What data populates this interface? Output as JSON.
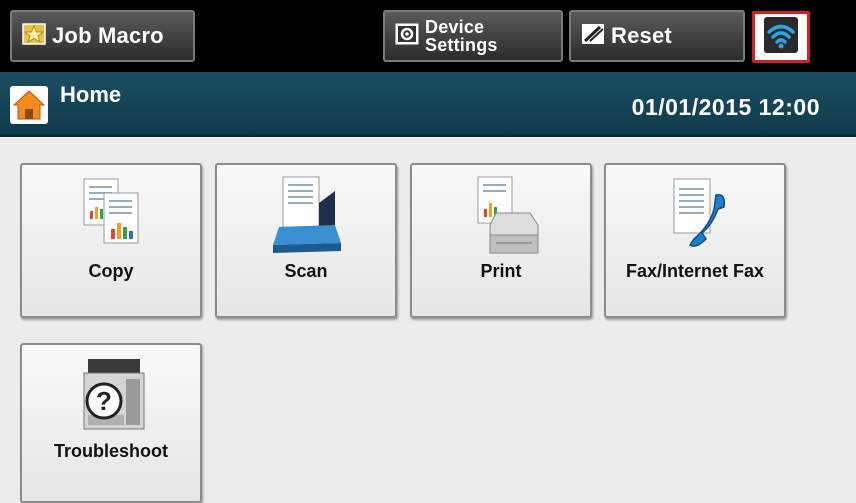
{
  "topbar": {
    "job_macro_label": "Job Macro",
    "device_settings_line1": "Device",
    "device_settings_line2": "Settings",
    "reset_label": "Reset"
  },
  "header": {
    "title": "Home",
    "datetime": "01/01/2015 12:00"
  },
  "tiles": [
    {
      "label": "Copy",
      "icon": "copy-icon"
    },
    {
      "label": "Scan",
      "icon": "scan-icon"
    },
    {
      "label": "Print",
      "icon": "print-icon"
    },
    {
      "label": "Fax/Internet Fax",
      "icon": "fax-icon"
    },
    {
      "label": "Troubleshoot",
      "icon": "troubleshoot-icon"
    }
  ],
  "colors": {
    "topbar": "#000000",
    "header": "#1c4f63",
    "background": "#ececec",
    "wifi_highlight": "#d42020"
  }
}
